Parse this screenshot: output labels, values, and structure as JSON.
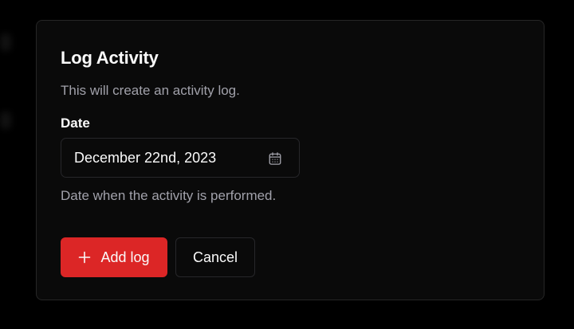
{
  "dialog": {
    "title": "Log Activity",
    "description": "This will create an activity log.",
    "date_field": {
      "label": "Date",
      "value": "December 22nd, 2023",
      "helper": "Date when the activity is performed.",
      "icon": "calendar-icon"
    },
    "actions": {
      "add_label": "Add log",
      "add_icon": "plus-icon",
      "cancel_label": "Cancel"
    }
  },
  "colors": {
    "background": "#000000",
    "dialog_bg": "#0a0a0a",
    "border": "#27272a",
    "text": "#fafafa",
    "muted_text": "#a1a1aa",
    "primary": "#dc2626"
  }
}
